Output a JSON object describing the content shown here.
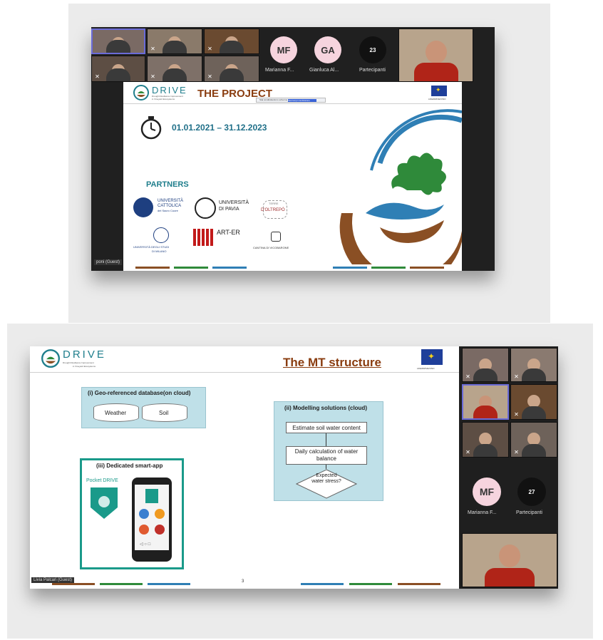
{
  "panel1": {
    "participants": [
      {
        "name": "",
        "muted": false
      },
      {
        "name": "",
        "muted": true
      },
      {
        "name": "",
        "muted": true
      },
      {
        "name": "",
        "muted": true
      },
      {
        "name": "",
        "muted": true
      },
      {
        "name": "",
        "muted": true
      }
    ],
    "avatars": [
      {
        "initials": "MF",
        "name": "Marianna F...",
        "color": "#f6d4de"
      },
      {
        "initials": "GA",
        "name": "Gianluca Al...",
        "color": "#f6d4de"
      }
    ],
    "participants_count": "23",
    "participants_label": "Partecipanti",
    "presenter_label": "poni (Guest)",
    "slide": {
      "logo_text": "DRIVE",
      "logo_sub1": "Drought Resilience Improvement",
      "logo_sub2": "in Vineyard Ecosystems",
      "title": "THE PROJECT",
      "dates": "01.01.2021 – 31.12.2023",
      "partners_heading": "PARTNERS",
      "eu_caption": "LIFE/DRIVE/VINO",
      "toolbar_text": "Stai condividendo lo schermo",
      "toolbar_button": "Interrompi condivisione",
      "partners": [
        {
          "line1": "UNIVERSITÀ",
          "line2": "CATTOLICA",
          "line3": "del Sacro Cuore"
        },
        {
          "line1": "UNIVERSITÀ",
          "line2": "DI PAVIA"
        },
        {
          "line1": "TERRE",
          "line2": "D'OLTREPÒ"
        },
        {
          "line1": "UNIVERSITÀ DEGLI STUDI",
          "line2": "DI MILANO"
        },
        {
          "line1": "ART-ER"
        },
        {
          "line1": "CANTINA DI VICOBARONE"
        }
      ]
    }
  },
  "panel2": {
    "slide": {
      "logo_text": "DRIVE",
      "logo_sub1": "Drought Resilience Improvement",
      "logo_sub2": "in Vineyard Ecosystems",
      "title": "The MT structure",
      "eu_caption": "LIFE/DRIVE/VINO",
      "db_title": "(i) Geo-referenced database(on cloud)",
      "db_items": [
        "Weather",
        "Soil"
      ],
      "model_title": "(ii) Modelling solutions (cloud)",
      "model_steps": [
        "Estimate soil water content",
        "Daily calculation of water balance"
      ],
      "model_decision": "Expected water stress?",
      "app_title": "(iii) Dedicated smart-app",
      "app_brand": "Pocket DRIVE",
      "page_number": "3"
    },
    "presenter_label": "Livia Palcari (Guest)",
    "side_participants": [
      {
        "muted": true
      },
      {
        "muted": true
      },
      {
        "muted": false
      },
      {
        "muted": true
      },
      {
        "muted": true
      },
      {
        "muted": true
      }
    ],
    "avatar": {
      "initials": "MF",
      "name": "Marianna F...",
      "color": "#f6d4de"
    },
    "participants_count": "27",
    "participants_label": "Partecipanti"
  },
  "colors": {
    "teal": "#1f7e8c",
    "green": "#2f8a3a",
    "blue": "#2f7fb5",
    "brown": "#8a4f24",
    "title_brown": "#8a3d10",
    "zoom_dark": "#202020"
  }
}
